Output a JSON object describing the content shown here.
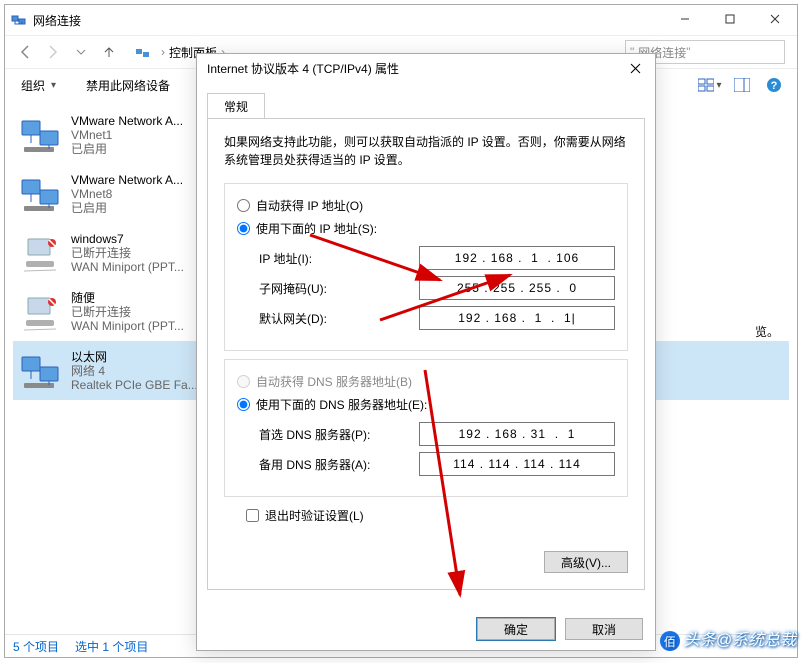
{
  "main": {
    "title": "网络连接",
    "breadcrumb": {
      "root": "控制面板",
      "search_hint": "网络连接"
    },
    "cmds": {
      "organize": "组织",
      "disable": "禁用此网络设备"
    },
    "items": [
      {
        "name": "VMware Network A...",
        "sub": "VMnet1",
        "status": "已启用",
        "selected": false,
        "kind": "vm"
      },
      {
        "name": "VMware Network A...",
        "sub": "VMnet8",
        "status": "已启用",
        "selected": false,
        "kind": "vm"
      },
      {
        "name": "windows7",
        "sub": "已断开连接",
        "status": "WAN Miniport (PPT...",
        "selected": false,
        "kind": "wan"
      },
      {
        "name": "随便",
        "sub": "已断开连接",
        "status": "WAN Miniport (PPT...",
        "selected": false,
        "kind": "wan"
      },
      {
        "name": "以太网",
        "sub": "网络 4",
        "status": "Realtek PCIe GBE Fa...",
        "selected": true,
        "kind": "eth"
      }
    ],
    "overlay_right": "览。",
    "status": {
      "total": "5 个项目",
      "selected": "选中 1 个项目"
    }
  },
  "dialog": {
    "title": "Internet 协议版本 4 (TCP/IPv4) 属性",
    "tab": "常规",
    "description": "如果网络支持此功能，则可以获取自动指派的 IP 设置。否则，你需要从网络系统管理员处获得适当的 IP 设置。",
    "ip_group": {
      "auto": "自动获得 IP 地址(O)",
      "manual": "使用下面的 IP 地址(S):",
      "fields": {
        "ip_label": "IP 地址(I):",
        "ip": "192 . 168 .  1  . 106",
        "mask_label": "子网掩码(U):",
        "mask": "255 . 255 . 255 .  0",
        "gw_label": "默认网关(D):",
        "gw": "192 . 168 .  1  .  1|"
      }
    },
    "dns_group": {
      "auto": "自动获得 DNS 服务器地址(B)",
      "manual": "使用下面的 DNS 服务器地址(E):",
      "fields": {
        "pref_label": "首选 DNS 服务器(P):",
        "pref": "192 . 168 . 31  .  1",
        "alt_label": "备用 DNS 服务器(A):",
        "alt": "114 . 114 . 114 . 114"
      }
    },
    "validate_on_exit": "退出时验证设置(L)",
    "advanced": "高级(V)...",
    "ok": "确定",
    "cancel": "取消"
  },
  "watermark": "头条@系统总裁"
}
